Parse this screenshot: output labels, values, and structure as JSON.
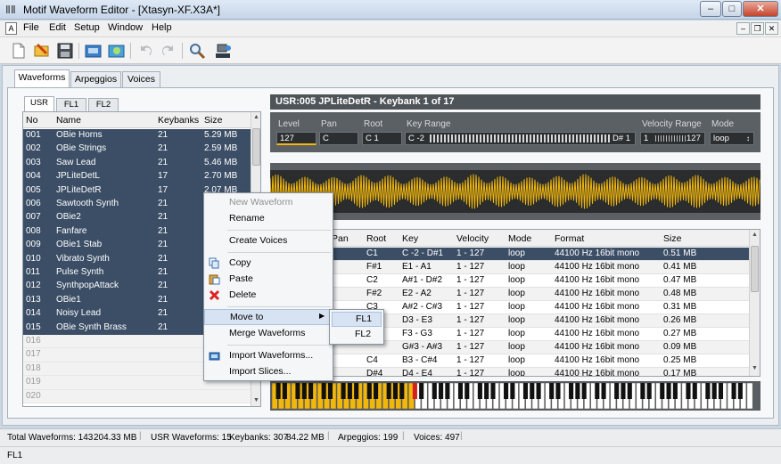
{
  "window": {
    "title": "Motif Waveform Editor - [Xtasyn-XF.X3A*]",
    "mdi_icon": "A"
  },
  "menu": [
    "File",
    "Edit",
    "Setup",
    "Window",
    "Help"
  ],
  "toolbar_icons": [
    "new-file-icon",
    "open-icon",
    "save-icon",
    "import-icon",
    "export-icon",
    "undo-icon",
    "redo-icon",
    "search-icon",
    "device-icon"
  ],
  "tabs": [
    {
      "label": "Waveforms",
      "active": true
    },
    {
      "label": "Arpeggios"
    },
    {
      "label": "Voices"
    }
  ],
  "banks": [
    {
      "label": "USR",
      "active": true
    },
    {
      "label": "FL1"
    },
    {
      "label": "FL2"
    }
  ],
  "list": {
    "headers": {
      "no": "No",
      "name": "Name",
      "keybanks": "Keybanks",
      "size": "Size"
    },
    "rows": [
      {
        "no": "001",
        "name": "OBie Horns",
        "keybanks": "21",
        "size": "5.29 MB"
      },
      {
        "no": "002",
        "name": "OBie Strings",
        "keybanks": "21",
        "size": "2.59 MB"
      },
      {
        "no": "003",
        "name": "Saw Lead",
        "keybanks": "21",
        "size": "5.46 MB"
      },
      {
        "no": "004",
        "name": "JPLiteDetL",
        "keybanks": "17",
        "size": "2.70 MB"
      },
      {
        "no": "005",
        "name": "JPLiteDetR",
        "keybanks": "17",
        "size": "2.07 MB"
      },
      {
        "no": "006",
        "name": "Sawtooth Synth",
        "keybanks": "21",
        "size": ""
      },
      {
        "no": "007",
        "name": "OBie2",
        "keybanks": "21",
        "size": ""
      },
      {
        "no": "008",
        "name": "Fanfare",
        "keybanks": "21",
        "size": ""
      },
      {
        "no": "009",
        "name": "OBie1 Stab",
        "keybanks": "21",
        "size": ""
      },
      {
        "no": "010",
        "name": "Vibrato Synth",
        "keybanks": "21",
        "size": ""
      },
      {
        "no": "011",
        "name": "Pulse Synth",
        "keybanks": "21",
        "size": ""
      },
      {
        "no": "012",
        "name": "SynthpopAttack",
        "keybanks": "21",
        "size": ""
      },
      {
        "no": "013",
        "name": "OBie1",
        "keybanks": "21",
        "size": ""
      },
      {
        "no": "014",
        "name": "Noisy Lead",
        "keybanks": "21",
        "size": ""
      },
      {
        "no": "015",
        "name": "OBie Synth Brass",
        "keybanks": "21",
        "size": ""
      },
      {
        "no": "016",
        "name": "",
        "keybanks": "",
        "size": ""
      },
      {
        "no": "017",
        "name": "",
        "keybanks": "",
        "size": ""
      },
      {
        "no": "018",
        "name": "",
        "keybanks": "",
        "size": ""
      },
      {
        "no": "019",
        "name": "",
        "keybanks": "",
        "size": ""
      },
      {
        "no": "020",
        "name": "",
        "keybanks": "",
        "size": ""
      }
    ]
  },
  "detail": {
    "title": "USR:005 JPLiteDetR - Keybank 1 of 17",
    "params": {
      "level_label": "Level",
      "level": "127",
      "pan_label": "Pan",
      "pan": "C",
      "root_label": "Root",
      "root": "C 1",
      "keyrange_label": "Key Range",
      "key_low": "C -2",
      "key_high": "D# 1",
      "velocity_label": "Velocity Range",
      "vel_low": "1",
      "vel_high": "127",
      "mode_label": "Mode",
      "mode": "loop"
    }
  },
  "zones": {
    "headers": {
      "pan": "Pan",
      "root": "Root",
      "key": "Key",
      "velocity": "Velocity",
      "mode": "Mode",
      "format": "Format",
      "size": "Size"
    },
    "rows": [
      {
        "root": "C1",
        "key": "C -2 - D#1",
        "velocity": "1 - 127",
        "mode": "loop",
        "format": "44100 Hz  16bit  mono",
        "size": "0.51 MB"
      },
      {
        "root": "F#1",
        "key": "E1 - A1",
        "velocity": "1 - 127",
        "mode": "loop",
        "format": "44100 Hz  16bit  mono",
        "size": "0.41 MB"
      },
      {
        "root": "C2",
        "key": "A#1 - D#2",
        "velocity": "1 - 127",
        "mode": "loop",
        "format": "44100 Hz  16bit  mono",
        "size": "0.47 MB"
      },
      {
        "root": "F#2",
        "key": "E2 - A2",
        "velocity": "1 - 127",
        "mode": "loop",
        "format": "44100 Hz  16bit  mono",
        "size": "0.48 MB"
      },
      {
        "root": "C3",
        "key": "A#2 - C#3",
        "velocity": "1 - 127",
        "mode": "loop",
        "format": "44100 Hz  16bit  mono",
        "size": "0.31 MB"
      },
      {
        "root": "",
        "key": "D3 - E3",
        "velocity": "1 - 127",
        "mode": "loop",
        "format": "44100 Hz  16bit  mono",
        "size": "0.26 MB"
      },
      {
        "root": "",
        "key": "F3 - G3",
        "velocity": "1 - 127",
        "mode": "loop",
        "format": "44100 Hz  16bit  mono",
        "size": "0.27 MB"
      },
      {
        "root": "",
        "key": "G#3 - A#3",
        "velocity": "1 - 127",
        "mode": "loop",
        "format": "44100 Hz  16bit  mono",
        "size": "0.09 MB"
      },
      {
        "root": "C4",
        "key": "B3 - C#4",
        "velocity": "1 - 127",
        "mode": "loop",
        "format": "44100 Hz  16bit  mono",
        "size": "0.25 MB"
      },
      {
        "root": "D#4",
        "key": "D4 - E4",
        "velocity": "1 - 127",
        "mode": "loop",
        "format": "44100 Hz  16bit  mono",
        "size": "0.17 MB"
      }
    ]
  },
  "context_menu": {
    "items": [
      {
        "label": "New Waveform",
        "disabled": true
      },
      {
        "label": "Rename"
      },
      {
        "label": "Create Voices"
      },
      {
        "label": "Copy",
        "icon": "copy-icon"
      },
      {
        "label": "Paste",
        "icon": "paste-icon"
      },
      {
        "label": "Delete",
        "icon": "delete-icon"
      },
      {
        "label": "Move to",
        "submenu": true
      },
      {
        "label": "Merge Waveforms"
      },
      {
        "label": "Import Waveforms...",
        "icon": "import-icon"
      },
      {
        "label": "Import Slices..."
      }
    ],
    "submenu": [
      "FL1",
      "FL2"
    ]
  },
  "status": {
    "total": "Total Waveforms: 143",
    "total_size": "204.33 MB",
    "usr": "USR  Waveforms: 15",
    "keybanks": "Keybanks: 307",
    "kb_size": "84.22 MB",
    "arpeggios": "Arpeggios: 199",
    "voices": "Voices: 497",
    "bottom": "FL1"
  },
  "colors": {
    "selection": "#3b4e66",
    "wave": "#f2b70c",
    "panel_dark": "#5b6064"
  }
}
